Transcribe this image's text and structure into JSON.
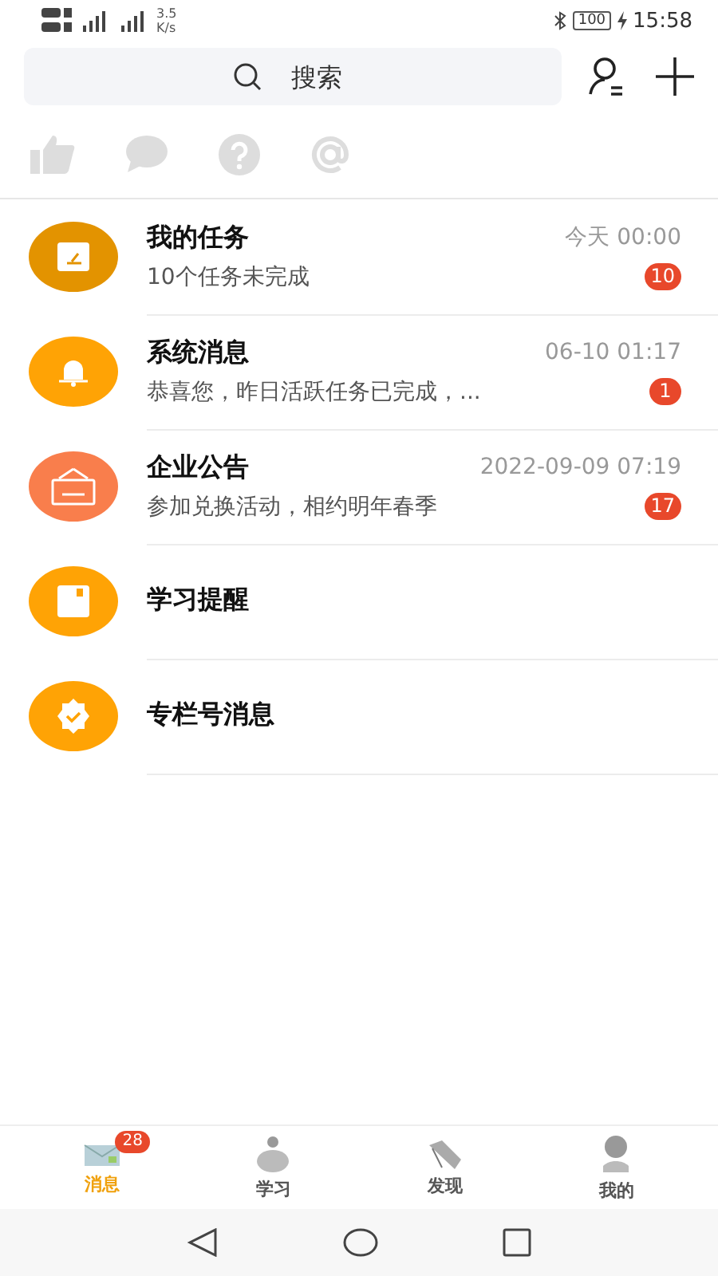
{
  "status_bar": {
    "speed": "3.5",
    "speed_unit": "K/s",
    "battery": "100",
    "time": "15:58"
  },
  "search": {
    "placeholder": "搜索"
  },
  "conversations": [
    {
      "title": "我的任务",
      "time": "今天 00:00",
      "preview": "10个任务未完成",
      "badge": "10",
      "color": "#e39300"
    },
    {
      "title": "系统消息",
      "time": "06-10 01:17",
      "preview": "恭喜您，昨日活跃任务已完成，...",
      "badge": "1",
      "color": "#ffa305"
    },
    {
      "title": "企业公告",
      "time": "2022-09-09 07:19",
      "preview": "参加兑换活动，相约明年春季",
      "badge": "17",
      "color": "#f97e4c"
    },
    {
      "title": "学习提醒",
      "color": "#ffa305"
    },
    {
      "title": "专栏号消息",
      "color": "#ffa305"
    }
  ],
  "tabs": [
    {
      "label": "消息",
      "selected": true,
      "badge": "28"
    },
    {
      "label": "学习",
      "selected": false
    },
    {
      "label": "发现",
      "selected": false
    },
    {
      "label": "我的",
      "selected": false
    }
  ]
}
